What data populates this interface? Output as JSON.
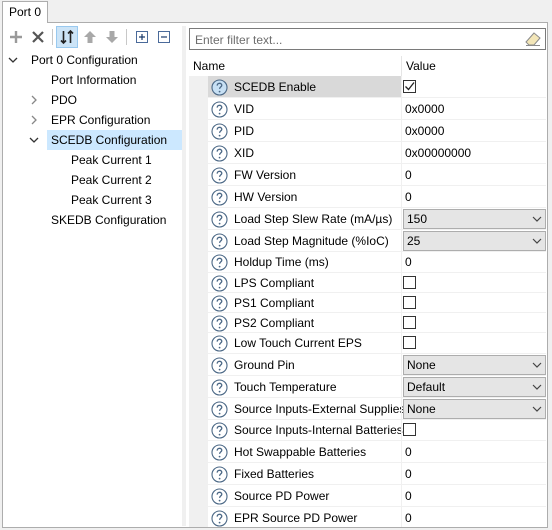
{
  "tab": {
    "label": "Port 0"
  },
  "filter": {
    "placeholder": "Enter filter text..."
  },
  "tree": [
    {
      "label": "Port 0 Configuration",
      "expander": "expanded"
    },
    {
      "label": "Port Information",
      "expander": "none"
    },
    {
      "label": "PDO",
      "expander": "collapsed"
    },
    {
      "label": "EPR Configuration",
      "expander": "collapsed"
    },
    {
      "label": "SCEDB Configuration",
      "expander": "expanded",
      "selected": true
    },
    {
      "label": "Peak Current 1",
      "expander": "none"
    },
    {
      "label": "Peak Current 2",
      "expander": "none"
    },
    {
      "label": "Peak Current 3",
      "expander": "none"
    },
    {
      "label": "SKEDB Configuration",
      "expander": "none"
    }
  ],
  "grid": {
    "headers": {
      "name": "Name",
      "value": "Value"
    },
    "rows": [
      {
        "name": "SCEDB Enable",
        "type": "checkbox",
        "checked": true,
        "selected": true
      },
      {
        "name": "VID",
        "type": "text",
        "value": "0x0000"
      },
      {
        "name": "PID",
        "type": "text",
        "value": "0x0000"
      },
      {
        "name": "XID",
        "type": "text",
        "value": "0x00000000"
      },
      {
        "name": "FW Version",
        "type": "text",
        "value": "0"
      },
      {
        "name": "HW Version",
        "type": "text",
        "value": "0"
      },
      {
        "name": "Load Step Slew Rate (mA/µs)",
        "type": "combo",
        "value": "150"
      },
      {
        "name": "Load Step Magnitude (%IoC)",
        "type": "combo",
        "value": "25"
      },
      {
        "name": "Holdup Time (ms)",
        "type": "text",
        "value": "0"
      },
      {
        "name": "LPS Compliant",
        "type": "checkbox",
        "checked": false
      },
      {
        "name": "PS1 Compliant",
        "type": "checkbox",
        "checked": false
      },
      {
        "name": "PS2 Compliant",
        "type": "checkbox",
        "checked": false
      },
      {
        "name": "Low Touch Current EPS",
        "type": "checkbox",
        "checked": false
      },
      {
        "name": "Ground Pin",
        "type": "combo",
        "value": "None"
      },
      {
        "name": "Touch Temperature",
        "type": "combo",
        "value": "Default"
      },
      {
        "name": "Source Inputs-External Supplies",
        "type": "combo",
        "value": "None"
      },
      {
        "name": "Source Inputs-Internal Batteries",
        "type": "checkbox",
        "checked": false
      },
      {
        "name": "Hot Swappable Batteries",
        "type": "text",
        "value": "0"
      },
      {
        "name": "Fixed Batteries",
        "type": "text",
        "value": "0"
      },
      {
        "name": "Source PD Power",
        "type": "text",
        "value": "0"
      },
      {
        "name": "EPR Source PD Power",
        "type": "text",
        "value": "0"
      }
    ]
  },
  "colors": {
    "selection": "#cce8ff",
    "help_icon": "#4a6785",
    "toolbar_active": "#cce4f7"
  },
  "icons": [
    "add-icon",
    "delete-icon",
    "sort-icon",
    "move-up-icon",
    "move-down-icon",
    "expand-all-icon",
    "collapse-all-icon",
    "eraser-icon",
    "help-icon",
    "checkmark-icon",
    "chevron-down-icon",
    "chevron-right-icon"
  ]
}
